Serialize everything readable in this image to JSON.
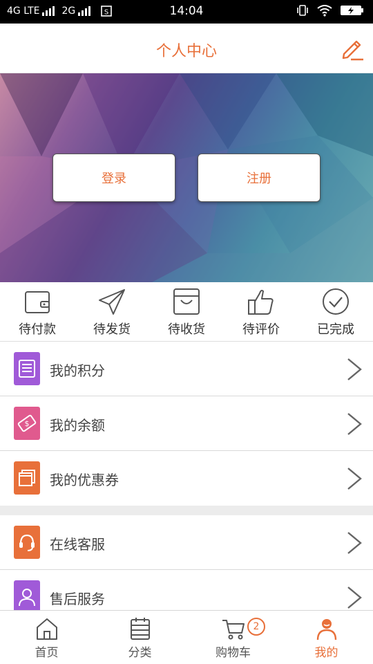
{
  "status_bar": {
    "network_1": "4G LTE",
    "network_2": "2G",
    "time": "14:04",
    "icons": [
      "signal-icon",
      "sim-icon",
      "vibrate-icon",
      "wifi-icon",
      "battery-icon"
    ]
  },
  "header": {
    "title": "个人中心",
    "edit_icon": "pencil-icon"
  },
  "banner": {
    "login_label": "登录",
    "register_label": "注册"
  },
  "orders": [
    {
      "label": "待付款",
      "icon": "wallet-icon"
    },
    {
      "label": "待发货",
      "icon": "paper-plane-icon"
    },
    {
      "label": "待收货",
      "icon": "box-icon"
    },
    {
      "label": "待评价",
      "icon": "thumbs-up-icon"
    },
    {
      "label": "已完成",
      "icon": "check-circle-icon"
    }
  ],
  "menu": [
    {
      "label": "我的积分",
      "icon": "list-icon",
      "color": "#a05ad8"
    },
    {
      "label": "我的余额",
      "icon": "money-icon",
      "color": "#e05a8e"
    },
    {
      "label": "我的优惠券",
      "icon": "coupon-icon",
      "color": "#e8703a"
    },
    {
      "label": "在线客服",
      "icon": "headset-icon",
      "color": "#e8703a"
    },
    {
      "label": "售后服务",
      "icon": "person-icon",
      "color": "#a05ad8"
    }
  ],
  "tabbar": [
    {
      "label": "首页",
      "icon": "home-icon"
    },
    {
      "label": "分类",
      "icon": "category-icon"
    },
    {
      "label": "购物车",
      "icon": "cart-icon",
      "badge": "2"
    },
    {
      "label": "我的",
      "icon": "user-icon",
      "active": true
    }
  ],
  "colors": {
    "accent": "#e8703a",
    "text": "#444444",
    "divider": "#d9d9d9"
  }
}
